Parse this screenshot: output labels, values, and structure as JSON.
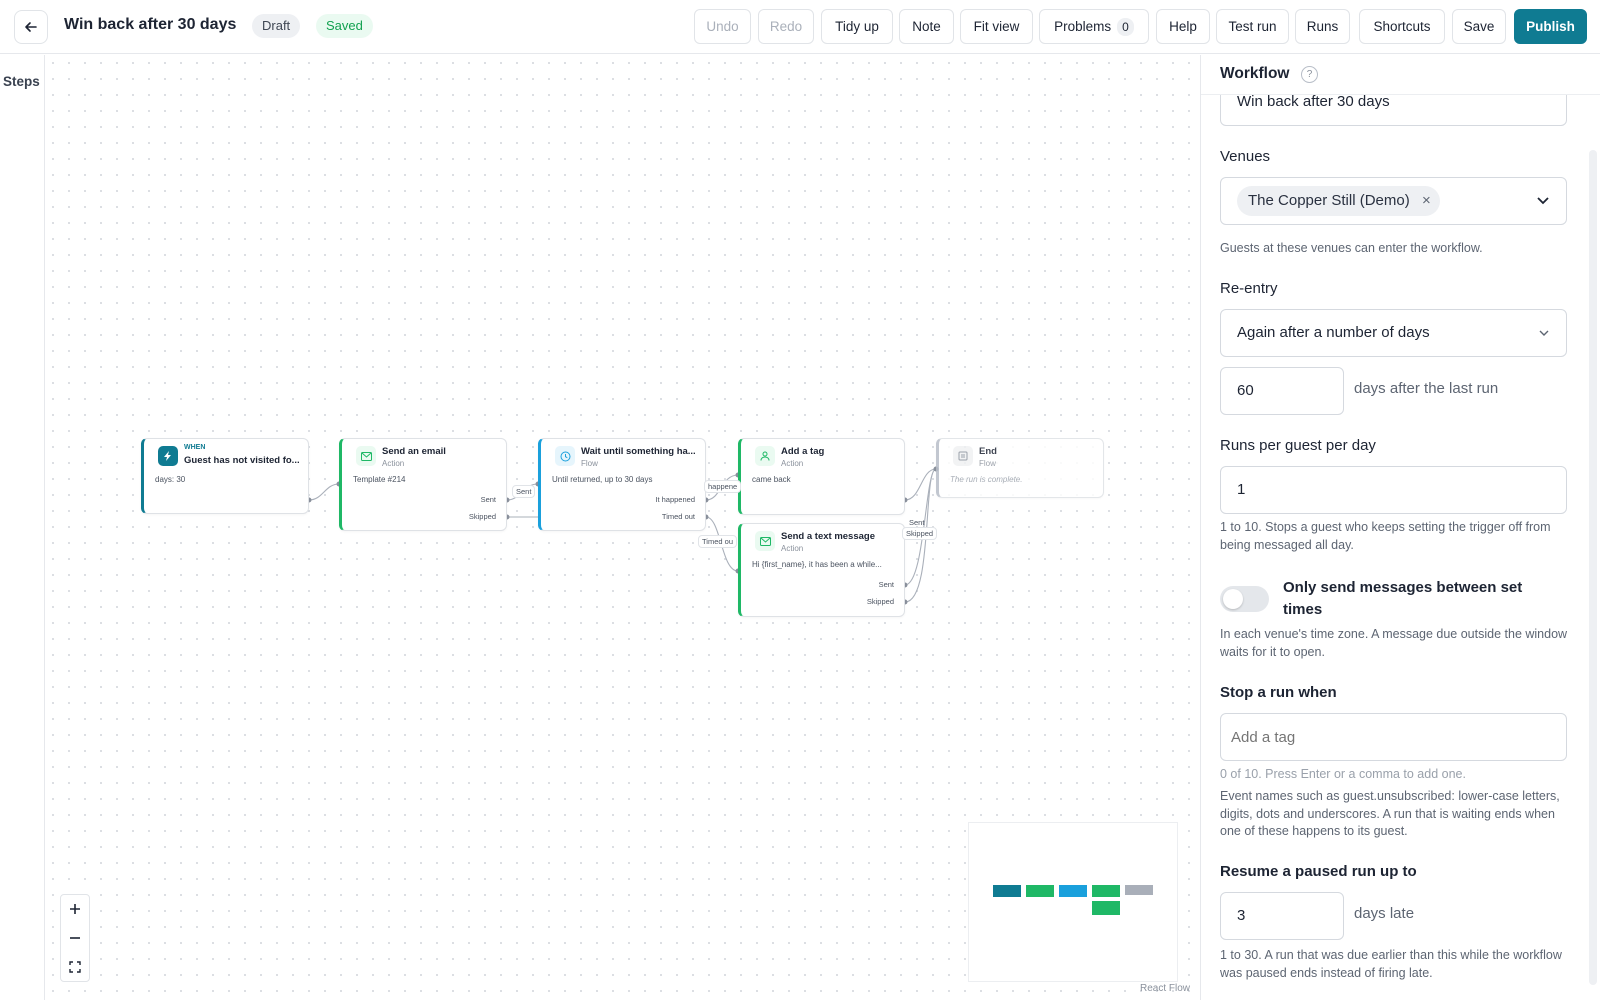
{
  "header": {
    "title": "Win back after 30 days",
    "status": "Draft",
    "save_state": "Saved",
    "buttons": {
      "undo": "Undo",
      "redo": "Redo",
      "tidy": "Tidy up",
      "note": "Note",
      "fit": "Fit view",
      "problems": "Problems",
      "problems_count": "0",
      "help": "Help",
      "test_run": "Test run",
      "runs": "Runs",
      "shortcuts": "Shortcuts",
      "save": "Save",
      "publish": "Publish"
    }
  },
  "sidebar": {
    "steps_tab": "Steps"
  },
  "nodes": {
    "trigger": {
      "eyebrow": "WHEN",
      "title": "Guest has not visited fo...",
      "body": "days: 30"
    },
    "email": {
      "title": "Send an email",
      "kind": "Action",
      "body": "Template #214",
      "port1": "Sent",
      "port2": "Skipped"
    },
    "wait": {
      "title": "Wait until something ha...",
      "kind": "Flow",
      "body": "Until returned, up to 30 days",
      "port1": "It happened",
      "port2": "Timed out"
    },
    "tag": {
      "title": "Add a tag",
      "kind": "Action",
      "body": "came back"
    },
    "sms": {
      "title": "Send a text message",
      "kind": "Action",
      "body": "Hi {first_name}, it has been a while...",
      "port1": "Sent",
      "port2": "Skipped"
    },
    "end": {
      "title": "End",
      "kind": "Flow",
      "body": "The run is complete."
    }
  },
  "edge_labels": {
    "sent": "Sent",
    "happened": "happene",
    "timed_out": "Timed ou",
    "sent2": "Sent",
    "skipped2": "Skipped"
  },
  "canvas": {
    "attribution": "React Flow"
  },
  "panel": {
    "title": "Workflow",
    "help_icon_text": "?",
    "name_value": "Win back after 30 days",
    "venues_label": "Venues",
    "venue_chip": "The Copper Still (Demo)",
    "venues_hint": "Guests at these venues can enter the workflow.",
    "reentry_label": "Re-entry",
    "reentry_value": "Again after a number of days",
    "reentry_days": "60",
    "reentry_days_suffix": "days after the last run",
    "runs_label": "Runs per guest per day",
    "runs_value": "1",
    "runs_hint": "1 to 10. Stops a guest who keeps setting the trigger off from being messaged all day.",
    "quiet_label": "Only send messages between set times",
    "quiet_enabled": false,
    "quiet_hint": "In each venue's time zone. A message due outside the window waits for it to open.",
    "stop_label": "Stop a run when",
    "stop_placeholder": "Add a tag",
    "stop_hint1": "0 of 10. Press Enter or a comma to add one.",
    "stop_hint2": "Event names such as guest.unsubscribed: lower-case letters, digits, dots and underscores. A run that is waiting ends when one of these happens to its guest.",
    "resume_label": "Resume a paused run up to",
    "resume_value": "3",
    "resume_suffix": "days late",
    "resume_hint": "1 to 30. A run that was due earlier than this while the workflow was paused ends instead of firing late."
  },
  "colors": {
    "brand": "#0f7b92",
    "action": "#1fb866",
    "flow": "#1aa0dc",
    "end": "#b8bec8",
    "saved": "#12a150"
  }
}
